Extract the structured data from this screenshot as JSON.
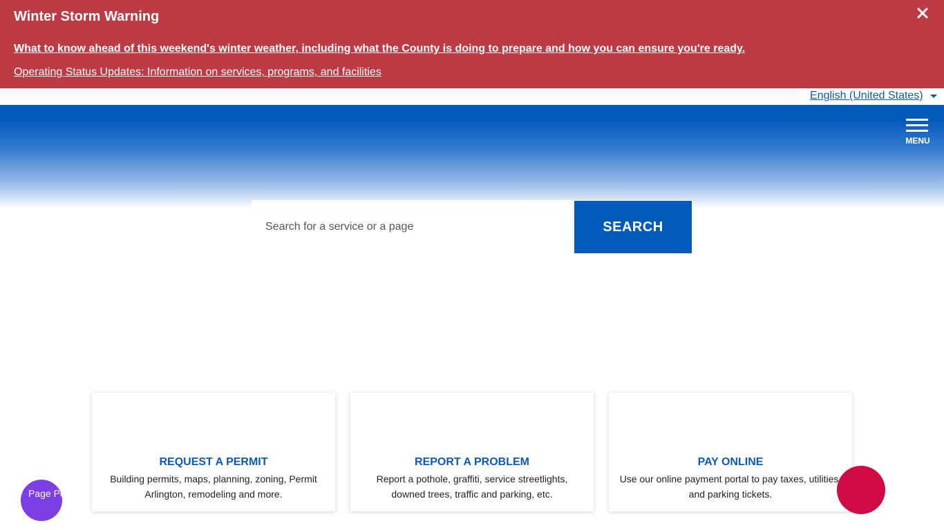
{
  "alert": {
    "title": "Winter Storm Warning",
    "link_primary": "What to know ahead of this weekend's winter weather, including what the County is doing to prepare and how you can ensure you're ready.",
    "link_secondary": "Operating Status Updates: Information on services, programs, and facilities",
    "close_icon": "close-icon",
    "color": "#bd3b44"
  },
  "language": {
    "selected": "English (United States)"
  },
  "header": {
    "menu_label": "MENU",
    "brand_color": "#035abb"
  },
  "search": {
    "placeholder": "Search for a service or a page",
    "value": "",
    "button_label": "SEARCH"
  },
  "cards": [
    {
      "title": "REQUEST A PERMIT",
      "description": "Building permits, maps, planning, zoning, Permit Arlington, remodeling and more."
    },
    {
      "title": "REPORT A PROBLEM",
      "description": "Report a pothole, graffiti, service streetlights, downed trees, traffic and parking, etc."
    },
    {
      "title": "PAY ONLINE",
      "description": "Use our online payment portal to pay taxes, utilities, and parking tickets."
    }
  ],
  "widgets": {
    "persona_alt": "Page Personalization On",
    "persona_color": "#7b3fe4",
    "feedback_color": "#cf0a44"
  }
}
